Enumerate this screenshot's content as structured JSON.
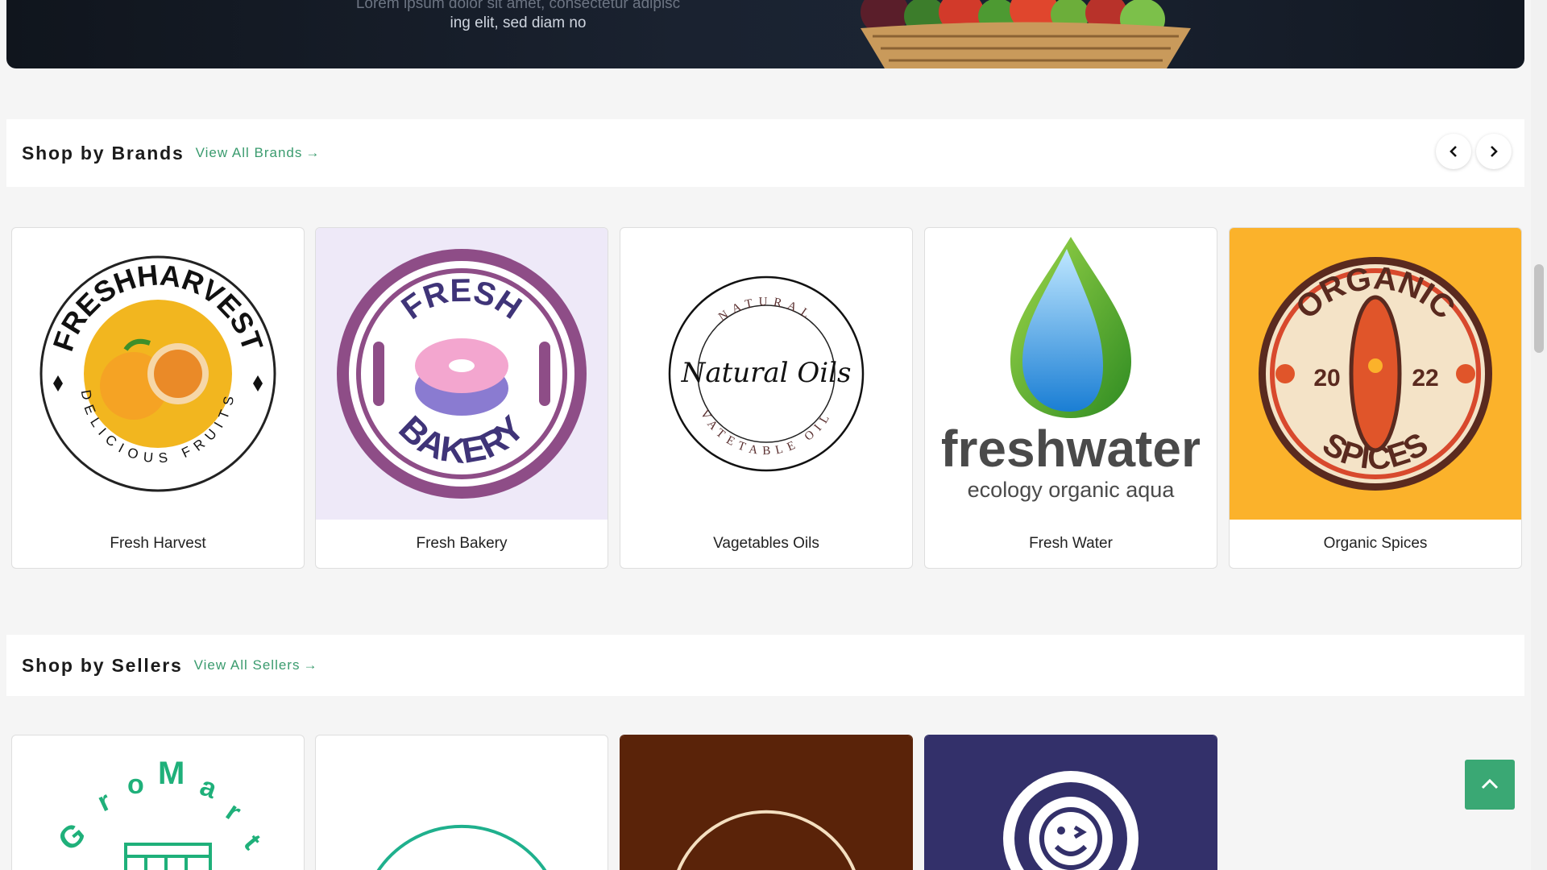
{
  "banner": {
    "text_line1": "Lorem ipsum dolor sit amet, consectetur adipisc",
    "text_line2": "ing elit, sed diam no"
  },
  "brands": {
    "title": "Shop by Brands",
    "view_all": "View All Brands",
    "items": [
      {
        "label": "Fresh Harvest",
        "logo": "fresh-harvest-logo"
      },
      {
        "label": "Fresh Bakery",
        "logo": "fresh-bakery-logo"
      },
      {
        "label": "Vagetables Oils",
        "logo": "natural-oils-logo"
      },
      {
        "label": "Fresh Water",
        "logo": "freshwater-logo"
      },
      {
        "label": "Organic Spices",
        "logo": "organic-spices-logo"
      }
    ]
  },
  "sellers": {
    "title": "Shop by Sellers",
    "view_all": "View All Sellers",
    "items": [
      {
        "logo": "gromart-logo"
      },
      {
        "logo": "teal-arc-logo"
      },
      {
        "logo": "brown-market-logo"
      },
      {
        "logo": "smiley-logo"
      }
    ]
  },
  "logo_text": {
    "fresh_harvest_top": "FRESHHARVEST",
    "fresh_harvest_bottom": "DELICIOUS FRUITS",
    "bakery_top": "FRESH",
    "bakery_bottom": "BAKERY",
    "oils_top": "NATURAL",
    "oils_center": "Natural Oils",
    "oils_bottom": "VATETABLE OIL",
    "freshwater_word": "freshwater",
    "freshwater_sub": "ecology organic aqua",
    "spices_top": "ORGANIC",
    "spices_bottom": "SPICES",
    "spices_year_left": "20",
    "spices_year_right": "22",
    "gromart": "GroMart"
  },
  "colors": {
    "accent": "#3aa874",
    "link": "#3a9b6e"
  }
}
